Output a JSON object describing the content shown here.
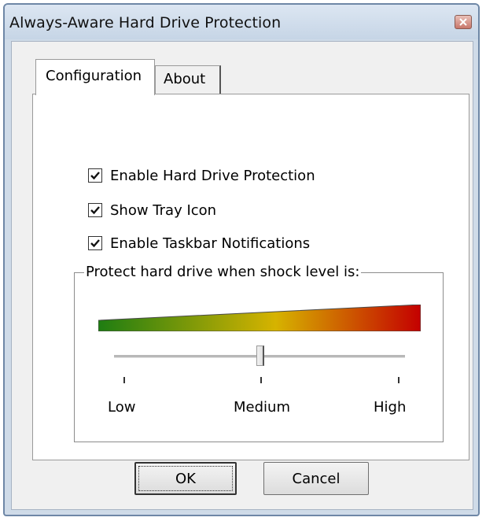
{
  "window": {
    "title": "Always-Aware Hard Drive Protection",
    "close_icon": "close-icon"
  },
  "tabs": [
    {
      "label": "Configuration",
      "selected": true
    },
    {
      "label": "About",
      "selected": false
    }
  ],
  "options": [
    {
      "label": "Enable Hard Drive Protection",
      "checked": true
    },
    {
      "label": "Show Tray Icon",
      "checked": true
    },
    {
      "label": "Enable Taskbar Notifications",
      "checked": true
    }
  ],
  "shock_level": {
    "group_label": "Protect hard drive when shock level is:",
    "ticks": [
      "Low",
      "Medium",
      "High"
    ],
    "value_fraction": 0.5,
    "gradient_colors": [
      "#1e7d12",
      "#d6b300",
      "#c40000"
    ]
  },
  "buttons": {
    "ok": "OK",
    "cancel": "Cancel"
  },
  "colors": {
    "titlebar": "#cfdbe8",
    "panel": "#ffffff",
    "dialog": "#f0f0f0"
  }
}
